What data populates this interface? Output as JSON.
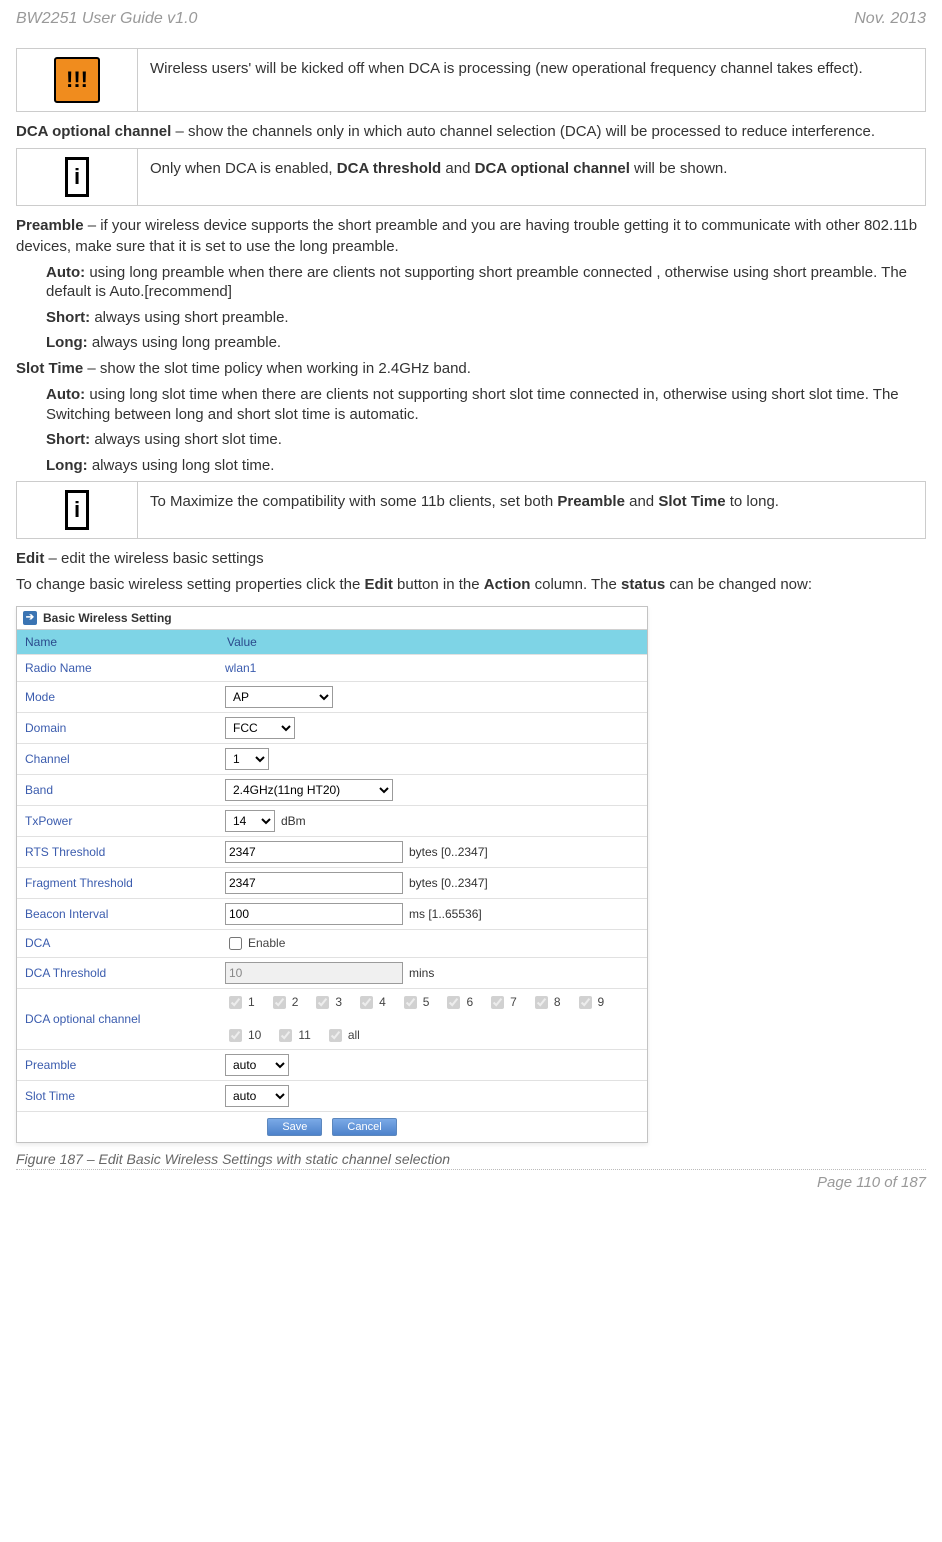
{
  "header": {
    "left": "BW2251 User Guide v1.0",
    "right": "Nov.  2013"
  },
  "note_dca": "Wireless users' will be kicked off when DCA is processing (new operational frequency channel takes effect).",
  "p_dca_channel": {
    "bold": "DCA optional channel",
    "rest": " – show the channels only in which auto channel selection (DCA) will be processed to reduce interference."
  },
  "note_dca_info": {
    "pre": "Only when DCA is enabled, ",
    "b1": "DCA threshold",
    "mid": " and ",
    "b2": "DCA optional channel",
    "post": " will be shown."
  },
  "p_preamble": {
    "bold": "Preamble",
    "rest": " – if your wireless device supports the short preamble and you are having trouble getting it to communicate with other 802.11b devices, make sure that it is set to use the long preamble."
  },
  "preamble_auto": {
    "bold": "Auto:",
    "rest": " using long preamble when there are clients not supporting short preamble connected , otherwise using short preamble. The default is Auto.[recommend]"
  },
  "preamble_short": {
    "bold": "Short:",
    "rest": " always using short preamble."
  },
  "preamble_long": {
    "bold": "Long:",
    "rest": " always using long preamble."
  },
  "p_slot": {
    "bold": "Slot Time",
    "rest": " – show the slot time policy when working in 2.4GHz band."
  },
  "slot_auto": {
    "bold": "Auto:",
    "rest": " using long slot time when there are clients not supporting short slot time connected in, otherwise using short slot time. The Switching between long and short slot time is automatic."
  },
  "slot_short": {
    "bold": "Short:",
    "rest": " always using short slot time."
  },
  "slot_long": {
    "bold": "Long:",
    "rest": " always using long slot time."
  },
  "note_compat": {
    "pre": "To Maximize the compatibility with some 11b clients, set both ",
    "b1": "Preamble",
    "mid": " and ",
    "b2": "Slot Time",
    "post": " to long."
  },
  "p_edit": {
    "bold": "Edit",
    "rest": " – edit the wireless basic settings"
  },
  "p_change": {
    "pre": "To change basic wireless setting properties click the ",
    "b1": "Edit",
    "mid1": " button in the ",
    "b2": "Action",
    "mid2": " column. The ",
    "b3": "status",
    "post": " can be changed now:"
  },
  "fig": {
    "title": "Basic Wireless Setting",
    "col1": "Name",
    "col2": "Value",
    "rows": {
      "radio_name": {
        "label": "Radio Name",
        "value": "wlan1"
      },
      "mode": {
        "label": "Mode",
        "value": "AP"
      },
      "domain": {
        "label": "Domain",
        "value": "FCC"
      },
      "channel": {
        "label": "Channel",
        "value": "1"
      },
      "band": {
        "label": "Band",
        "value": "2.4GHz(11ng HT20)"
      },
      "txpower": {
        "label": "TxPower",
        "value": "14",
        "unit": "dBm"
      },
      "rts": {
        "label": "RTS Threshold",
        "value": "2347",
        "unit": "bytes [0..2347]"
      },
      "frag": {
        "label": "Fragment Threshold",
        "value": "2347",
        "unit": "bytes [0..2347]"
      },
      "beacon": {
        "label": "Beacon Interval",
        "value": "100",
        "unit": "ms [1..65536]"
      },
      "dca": {
        "label": "DCA",
        "chk_label": "Enable"
      },
      "dca_thresh": {
        "label": "DCA Threshold",
        "value": "10",
        "unit": "mins"
      },
      "dca_opt": {
        "label": "DCA optional channel",
        "items": [
          "1",
          "2",
          "3",
          "4",
          "5",
          "6",
          "7",
          "8",
          "9",
          "10",
          "11",
          "all"
        ]
      },
      "preamble": {
        "label": "Preamble",
        "value": "auto"
      },
      "slot": {
        "label": "Slot Time",
        "value": "auto"
      }
    },
    "save": "Save",
    "cancel": "Cancel"
  },
  "caption": "Figure 187 – Edit Basic Wireless Settings with static channel selection",
  "footer": "Page 110 of 187"
}
